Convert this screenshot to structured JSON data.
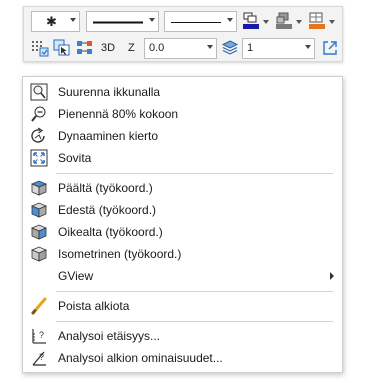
{
  "toolbar": {
    "row1": {
      "point_style": "✱",
      "line_style": "",
      "line_weight": "",
      "pen_color": "#1a1aa8",
      "fill_color": "#7a7a7a",
      "layer_color": "#e8741b"
    },
    "row2": {
      "label_3d": "3D",
      "label_z": "Z",
      "z_value": "0.0",
      "layer_value": "1"
    }
  },
  "menu": {
    "items": [
      {
        "label": "Suurenna ikkunalla",
        "icon": "zoom-window-icon"
      },
      {
        "label": "Pienennä 80% kokoon",
        "icon": "zoom-out-icon"
      },
      {
        "label": "Dynaaminen kierto",
        "icon": "rotate-icon"
      },
      {
        "label": "Sovita",
        "icon": "fit-icon"
      },
      {
        "label": "Päältä (työkoord.)",
        "icon": "view-top-icon"
      },
      {
        "label": "Edestä (työkoord.)",
        "icon": "view-front-icon"
      },
      {
        "label": "Oikealta (työkoord.)",
        "icon": "view-right-icon"
      },
      {
        "label": "Isometrinen (työkoord.)",
        "icon": "view-iso-icon"
      },
      {
        "label": "GView",
        "icon": ""
      },
      {
        "label": "Poista alkiota",
        "icon": "delete-pencil-icon"
      },
      {
        "label": "Analysoi etäisyys...",
        "icon": "measure-distance-icon"
      },
      {
        "label": "Analysoi alkion ominaisuudet...",
        "icon": "analyze-properties-icon"
      }
    ]
  }
}
